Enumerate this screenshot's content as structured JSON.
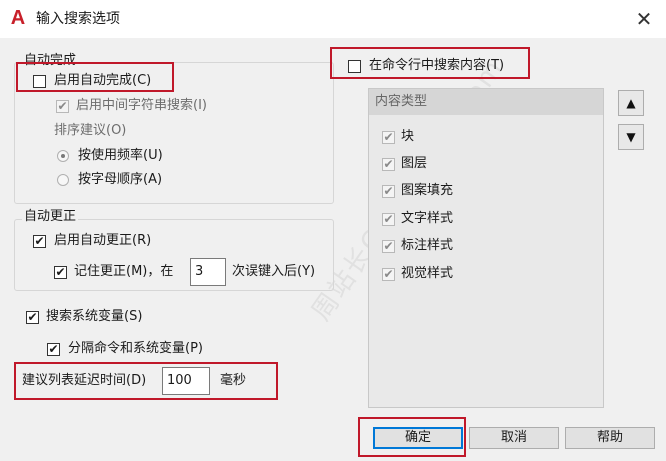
{
  "window": {
    "title": "输入搜索选项",
    "logo_letter": "A",
    "close_symbol": "✕"
  },
  "autocomplete": {
    "group_label": "自动完成",
    "enable_label": "启用自动完成(C)",
    "enable_checked": false,
    "mid_string_label": "启用中间字符串搜索(I)",
    "mid_string_checked": true,
    "sort_label": "排序建议(O)",
    "sort_options": [
      {
        "label": "按使用频率(U)",
        "selected": true
      },
      {
        "label": "按字母顺序(A)",
        "selected": false
      }
    ]
  },
  "autocorrect": {
    "group_label": "自动更正",
    "enable_label": "启用自动更正(R)",
    "enable_checked": true,
    "remember_label": "记住更正(M)，在",
    "remember_checked": true,
    "remember_count": "3",
    "remember_suffix": "次误键入后(Y)"
  },
  "sysvar": {
    "search_label": "搜索系统变量(S)",
    "search_checked": true,
    "separate_label": "分隔命令和系统变量(P)",
    "separate_checked": true
  },
  "delay": {
    "label": "建议列表延迟时间(D)",
    "value": "100",
    "unit": "毫秒"
  },
  "content_search": {
    "label": "在命令行中搜索内容(T)",
    "checked": false
  },
  "content_types": {
    "header": "内容类型",
    "items": [
      {
        "label": "块",
        "checked": true
      },
      {
        "label": "图层",
        "checked": true
      },
      {
        "label": "图案填充",
        "checked": true
      },
      {
        "label": "文字样式",
        "checked": true
      },
      {
        "label": "标注样式",
        "checked": true
      },
      {
        "label": "视觉样式",
        "checked": true
      }
    ]
  },
  "buttons": {
    "ok": "确定",
    "cancel": "取消",
    "help": "帮助",
    "move_up": "▲",
    "move_down": "▼"
  },
  "watermark_text": "周站长CAD zzcad.com",
  "colors": {
    "highlight_red": "#c0182a",
    "logo_red": "#c8202a",
    "default_button_blue": "#0078d7",
    "dialog_bg": "#f0f0f0"
  }
}
